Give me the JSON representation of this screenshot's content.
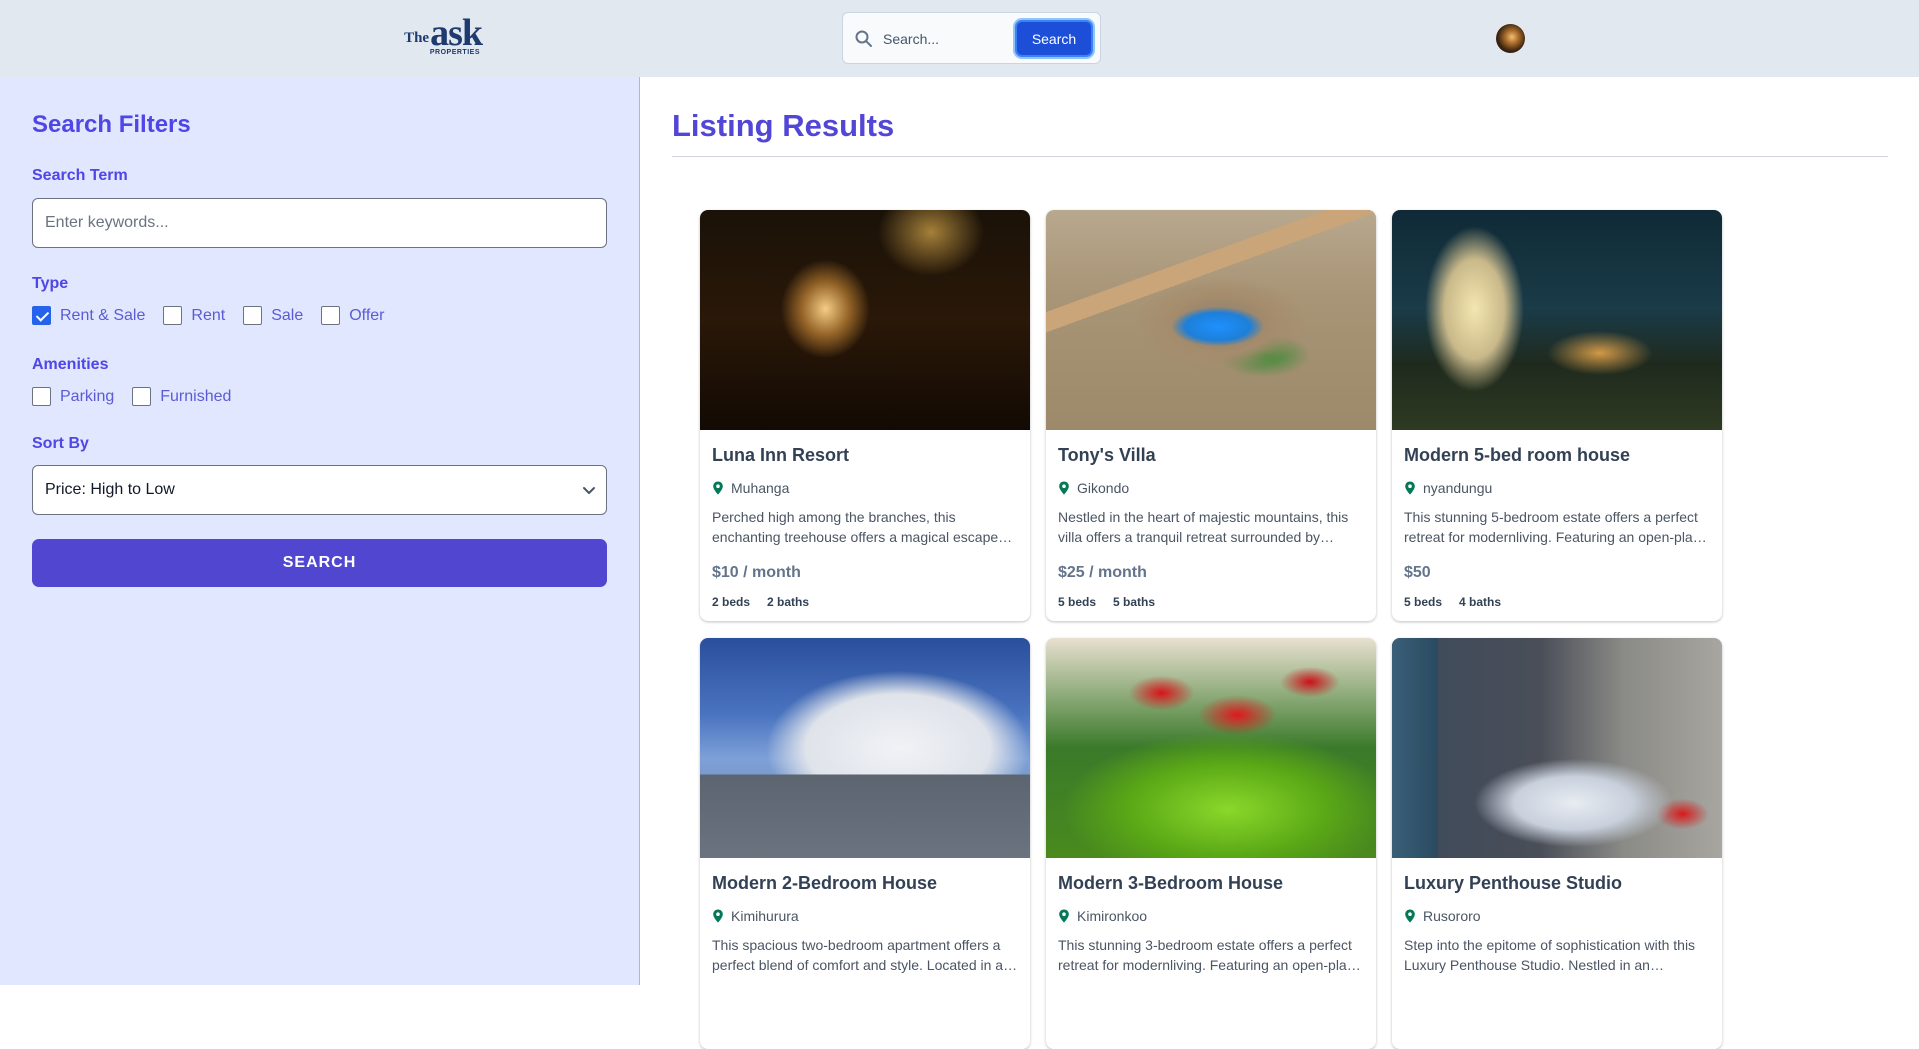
{
  "header": {
    "logo": {
      "the": "The",
      "ask": "ask",
      "sub": "PROPERTIES"
    },
    "search": {
      "placeholder": "Search...",
      "button_label": "Search"
    }
  },
  "sidebar": {
    "title": "Search Filters",
    "search_term": {
      "label": "Search Term",
      "placeholder": "Enter keywords..."
    },
    "type": {
      "label": "Type",
      "options": [
        {
          "label": "Rent & Sale",
          "checked": true
        },
        {
          "label": "Rent",
          "checked": false
        },
        {
          "label": "Sale",
          "checked": false
        },
        {
          "label": "Offer",
          "checked": false
        }
      ]
    },
    "amenities": {
      "label": "Amenities",
      "options": [
        {
          "label": "Parking",
          "checked": false
        },
        {
          "label": "Furnished",
          "checked": false
        }
      ]
    },
    "sort": {
      "label": "Sort By",
      "selected": "Price: High to Low"
    },
    "submit_label": "SEARCH"
  },
  "main": {
    "title": "Listing Results",
    "listings": [
      {
        "title": "Luna Inn Resort",
        "location": "Muhanga",
        "description": "Perched high among the branches, this enchanting treehouse offers a magical escape into nature.",
        "price": "$10 / month",
        "beds": "2 beds",
        "baths": "2 baths"
      },
      {
        "title": "Tony's Villa",
        "location": "Gikondo",
        "description": "Nestled in the heart of majestic mountains, this villa offers a tranquil retreat surrounded by breathtaking views.",
        "price": "$25 / month",
        "beds": "5 beds",
        "baths": "5 baths"
      },
      {
        "title": "Modern 5-bed room house",
        "location": "nyandungu",
        "description": "This stunning 5-bedroom estate offers a perfect retreat for modernliving. Featuring an open-plan layout.",
        "price": "$50",
        "beds": "5 beds",
        "baths": "4 baths"
      },
      {
        "title": "Modern 2-Bedroom House",
        "location": "Kimihurura",
        "description": "This spacious two-bedroom apartment offers a perfect blend of comfort and style. Located in a quiet neighborhood.",
        "price": "",
        "beds": "",
        "baths": ""
      },
      {
        "title": "Modern 3-Bedroom House",
        "location": "Kimironkoo",
        "description": "This stunning 3-bedroom estate offers a perfect retreat for modernliving. Featuring an open-plan layout.",
        "price": "",
        "beds": "",
        "baths": ""
      },
      {
        "title": "Luxury Penthouse Studio",
        "location": "Rusororo",
        "description": "Step into the epitome of sophistication with this Luxury Penthouse Studio. Nestled in an exclusive area.",
        "price": "",
        "beds": "",
        "baths": ""
      }
    ]
  },
  "colors": {
    "header_bg": "#e2e8f0",
    "sidebar_bg": "#e0e7ff",
    "accent": "#4f46e5",
    "search_button": "#1d4ed8",
    "pin": "#047857"
  }
}
